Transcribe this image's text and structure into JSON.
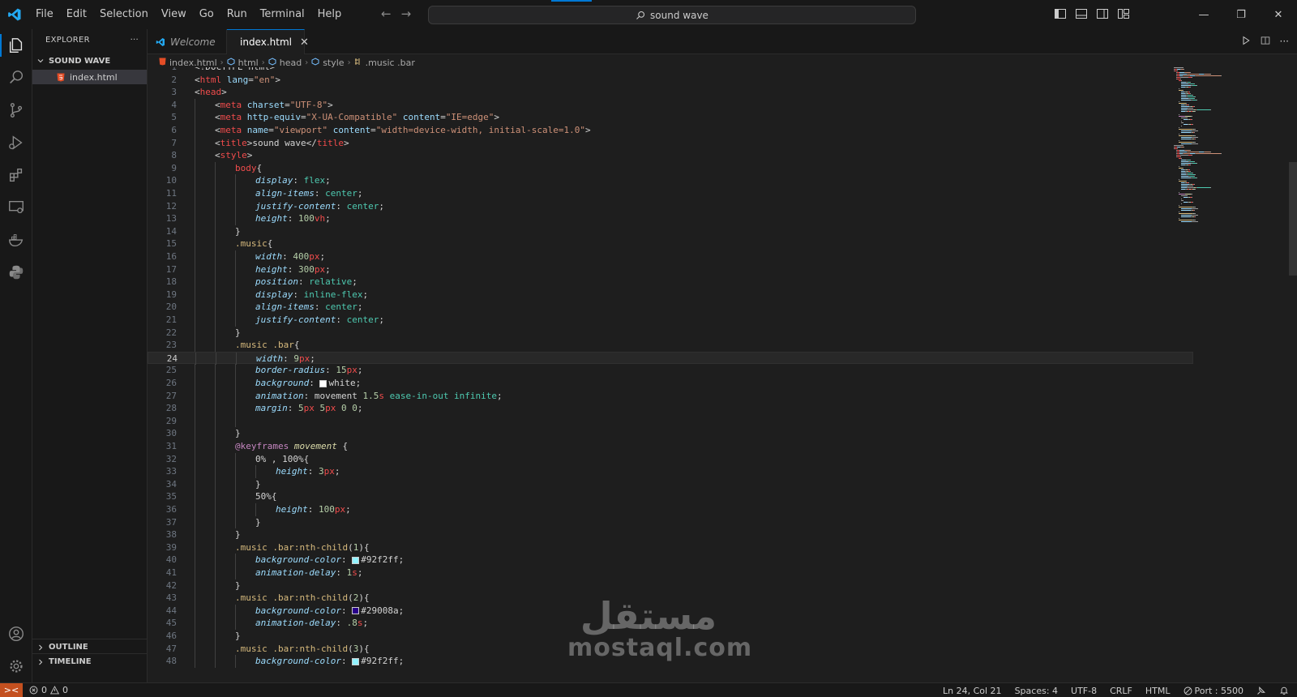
{
  "window": {
    "search_text": "sound wave"
  },
  "menu": [
    "File",
    "Edit",
    "Selection",
    "View",
    "Go",
    "Run",
    "Terminal",
    "Help"
  ],
  "sidebar": {
    "title": "EXPLORER",
    "more": "···",
    "folder": "SOUND WAVE",
    "files": [
      "index.html"
    ],
    "outline": "OUTLINE",
    "timeline": "TIMELINE"
  },
  "tabs": [
    {
      "label": "Welcome",
      "active": false
    },
    {
      "label": "index.html",
      "active": true
    }
  ],
  "breadcrumb": [
    "index.html",
    "html",
    "head",
    "style",
    ".music .bar"
  ],
  "editor": {
    "current_line": 24,
    "lines": [
      {
        "n": 1,
        "indent": 0,
        "tokens": [
          [
            "p",
            "<!DOCTYPE html>"
          ]
        ]
      },
      {
        "n": 2,
        "indent": 0,
        "tokens": [
          [
            "p",
            "<"
          ],
          [
            "t",
            "html"
          ],
          [
            "a",
            " lang"
          ],
          [
            "p",
            "="
          ],
          [
            "s",
            "\"en\""
          ],
          [
            "p",
            ">"
          ]
        ]
      },
      {
        "n": 3,
        "indent": 0,
        "tokens": [
          [
            "p",
            "<"
          ],
          [
            "t",
            "head"
          ],
          [
            "p",
            ">"
          ]
        ]
      },
      {
        "n": 4,
        "indent": 1,
        "tokens": [
          [
            "p",
            "<"
          ],
          [
            "t",
            "meta"
          ],
          [
            "a",
            " charset"
          ],
          [
            "p",
            "="
          ],
          [
            "s",
            "\"UTF-8\""
          ],
          [
            "p",
            ">"
          ]
        ]
      },
      {
        "n": 5,
        "indent": 1,
        "tokens": [
          [
            "p",
            "<"
          ],
          [
            "t",
            "meta"
          ],
          [
            "a",
            " http-equiv"
          ],
          [
            "p",
            "="
          ],
          [
            "s",
            "\"X-UA-Compatible\""
          ],
          [
            "a",
            " content"
          ],
          [
            "p",
            "="
          ],
          [
            "s",
            "\"IE=edge\""
          ],
          [
            "p",
            ">"
          ]
        ]
      },
      {
        "n": 6,
        "indent": 1,
        "tokens": [
          [
            "p",
            "<"
          ],
          [
            "t",
            "meta"
          ],
          [
            "a",
            " name"
          ],
          [
            "p",
            "="
          ],
          [
            "s",
            "\"viewport\""
          ],
          [
            "a",
            " content"
          ],
          [
            "p",
            "="
          ],
          [
            "s",
            "\"width=device-width, initial-scale=1.0\""
          ],
          [
            "p",
            ">"
          ]
        ]
      },
      {
        "n": 7,
        "indent": 1,
        "tokens": [
          [
            "p",
            "<"
          ],
          [
            "t",
            "title"
          ],
          [
            "p",
            ">sound wave</"
          ],
          [
            "t",
            "title"
          ],
          [
            "p",
            ">"
          ]
        ]
      },
      {
        "n": 8,
        "indent": 1,
        "tokens": [
          [
            "p",
            "<"
          ],
          [
            "t",
            "style"
          ],
          [
            "p",
            ">"
          ]
        ]
      },
      {
        "n": 9,
        "indent": 2,
        "tokens": [
          [
            "t",
            "body"
          ],
          [
            "p",
            "{"
          ]
        ]
      },
      {
        "n": 10,
        "indent": 3,
        "tokens": [
          [
            "prop",
            "display"
          ],
          [
            "p",
            ": "
          ],
          [
            "val",
            "flex"
          ],
          [
            "p",
            ";"
          ]
        ]
      },
      {
        "n": 11,
        "indent": 3,
        "tokens": [
          [
            "prop",
            "align-items"
          ],
          [
            "p",
            ": "
          ],
          [
            "val",
            "center"
          ],
          [
            "p",
            ";"
          ]
        ]
      },
      {
        "n": 12,
        "indent": 3,
        "tokens": [
          [
            "prop",
            "justify-content"
          ],
          [
            "p",
            ": "
          ],
          [
            "val",
            "center"
          ],
          [
            "p",
            ";"
          ]
        ]
      },
      {
        "n": 13,
        "indent": 3,
        "tokens": [
          [
            "prop",
            "height"
          ],
          [
            "p",
            ": "
          ],
          [
            "num",
            "100"
          ],
          [
            "unit",
            "vh"
          ],
          [
            "p",
            ";"
          ]
        ]
      },
      {
        "n": 14,
        "indent": 2,
        "tokens": [
          [
            "p",
            "}"
          ]
        ]
      },
      {
        "n": 15,
        "indent": 2,
        "tokens": [
          [
            "sel",
            ".music"
          ],
          [
            "p",
            "{"
          ]
        ]
      },
      {
        "n": 16,
        "indent": 3,
        "tokens": [
          [
            "prop",
            "width"
          ],
          [
            "p",
            ": "
          ],
          [
            "num",
            "400"
          ],
          [
            "unit",
            "px"
          ],
          [
            "p",
            ";"
          ]
        ]
      },
      {
        "n": 17,
        "indent": 3,
        "tokens": [
          [
            "prop",
            "height"
          ],
          [
            "p",
            ": "
          ],
          [
            "num",
            "300"
          ],
          [
            "unit",
            "px"
          ],
          [
            "p",
            ";"
          ]
        ]
      },
      {
        "n": 18,
        "indent": 3,
        "tokens": [
          [
            "prop",
            "position"
          ],
          [
            "p",
            ": "
          ],
          [
            "val",
            "relative"
          ],
          [
            "p",
            ";"
          ]
        ]
      },
      {
        "n": 19,
        "indent": 3,
        "tokens": [
          [
            "prop",
            "display"
          ],
          [
            "p",
            ": "
          ],
          [
            "val",
            "inline-flex"
          ],
          [
            "p",
            ";"
          ]
        ]
      },
      {
        "n": 20,
        "indent": 3,
        "tokens": [
          [
            "prop",
            "align-items"
          ],
          [
            "p",
            ": "
          ],
          [
            "val",
            "center"
          ],
          [
            "p",
            ";"
          ]
        ]
      },
      {
        "n": 21,
        "indent": 3,
        "tokens": [
          [
            "prop",
            "justify-content"
          ],
          [
            "p",
            ": "
          ],
          [
            "val",
            "center"
          ],
          [
            "p",
            ";"
          ]
        ]
      },
      {
        "n": 22,
        "indent": 2,
        "tokens": [
          [
            "p",
            "}"
          ]
        ]
      },
      {
        "n": 23,
        "indent": 2,
        "tokens": [
          [
            "sel",
            ".music .bar"
          ],
          [
            "p",
            "{"
          ]
        ]
      },
      {
        "n": 24,
        "indent": 3,
        "tokens": [
          [
            "prop",
            "width"
          ],
          [
            "p",
            ": "
          ],
          [
            "num",
            "9"
          ],
          [
            "unit",
            "px"
          ],
          [
            "p",
            ";"
          ]
        ]
      },
      {
        "n": 25,
        "indent": 3,
        "tokens": [
          [
            "prop",
            "border-radius"
          ],
          [
            "p",
            ": "
          ],
          [
            "num",
            "15"
          ],
          [
            "unit",
            "px"
          ],
          [
            "p",
            ";"
          ]
        ]
      },
      {
        "n": 26,
        "indent": 3,
        "tokens": [
          [
            "prop",
            "background"
          ],
          [
            "p",
            ": "
          ],
          [
            "swatch",
            "#ffffff"
          ],
          [
            "p",
            "white;"
          ]
        ]
      },
      {
        "n": 27,
        "indent": 3,
        "tokens": [
          [
            "prop",
            "animation"
          ],
          [
            "p",
            ": movement "
          ],
          [
            "num",
            "1.5"
          ],
          [
            "unit",
            "s"
          ],
          [
            "val",
            " ease-in-out infinite"
          ],
          [
            "p",
            ";"
          ]
        ]
      },
      {
        "n": 28,
        "indent": 3,
        "tokens": [
          [
            "prop",
            "margin"
          ],
          [
            "p",
            ": "
          ],
          [
            "num",
            "5"
          ],
          [
            "unit",
            "px"
          ],
          [
            "num",
            " 5"
          ],
          [
            "unit",
            "px"
          ],
          [
            "num",
            " 0 0"
          ],
          [
            "p",
            ";"
          ]
        ]
      },
      {
        "n": 29,
        "indent": 3,
        "tokens": []
      },
      {
        "n": 30,
        "indent": 2,
        "tokens": [
          [
            "p",
            "}"
          ]
        ]
      },
      {
        "n": 31,
        "indent": 2,
        "tokens": [
          [
            "kw",
            "@keyframes"
          ],
          [
            "anim",
            " movement"
          ],
          [
            "p",
            " {"
          ]
        ]
      },
      {
        "n": 32,
        "indent": 3,
        "tokens": [
          [
            "p",
            "0% , 100%{"
          ]
        ]
      },
      {
        "n": 33,
        "indent": 4,
        "tokens": [
          [
            "prop",
            "height"
          ],
          [
            "p",
            ": "
          ],
          [
            "num",
            "3"
          ],
          [
            "unit",
            "px"
          ],
          [
            "p",
            ";"
          ]
        ]
      },
      {
        "n": 34,
        "indent": 3,
        "tokens": [
          [
            "p",
            "}"
          ]
        ]
      },
      {
        "n": 35,
        "indent": 3,
        "tokens": [
          [
            "p",
            "50%{"
          ]
        ]
      },
      {
        "n": 36,
        "indent": 4,
        "tokens": [
          [
            "prop",
            "height"
          ],
          [
            "p",
            ": "
          ],
          [
            "num",
            "100"
          ],
          [
            "unit",
            "px"
          ],
          [
            "p",
            ";"
          ]
        ]
      },
      {
        "n": 37,
        "indent": 3,
        "tokens": [
          [
            "p",
            "}"
          ]
        ]
      },
      {
        "n": 38,
        "indent": 2,
        "tokens": [
          [
            "p",
            "}"
          ]
        ]
      },
      {
        "n": 39,
        "indent": 2,
        "tokens": [
          [
            "sel",
            ".music .bar:nth-child"
          ],
          [
            "p",
            "("
          ],
          [
            "num",
            "1"
          ],
          [
            "p",
            ")"
          ],
          [
            "p",
            "{"
          ]
        ]
      },
      {
        "n": 40,
        "indent": 3,
        "tokens": [
          [
            "prop",
            "background-color"
          ],
          [
            "p",
            ": "
          ],
          [
            "swatch",
            "#92f2ff"
          ],
          [
            "p",
            "#92f2ff;"
          ]
        ]
      },
      {
        "n": 41,
        "indent": 3,
        "tokens": [
          [
            "prop",
            "animation-delay"
          ],
          [
            "p",
            ": "
          ],
          [
            "num",
            "1"
          ],
          [
            "unit",
            "s"
          ],
          [
            "p",
            ";"
          ]
        ]
      },
      {
        "n": 42,
        "indent": 2,
        "tokens": [
          [
            "p",
            "}"
          ]
        ]
      },
      {
        "n": 43,
        "indent": 2,
        "tokens": [
          [
            "sel",
            ".music .bar:nth-child"
          ],
          [
            "p",
            "("
          ],
          [
            "num",
            "2"
          ],
          [
            "p",
            ")"
          ],
          [
            "p",
            "{"
          ]
        ]
      },
      {
        "n": 44,
        "indent": 3,
        "tokens": [
          [
            "prop",
            "background-color"
          ],
          [
            "p",
            ": "
          ],
          [
            "swatch",
            "#29008a"
          ],
          [
            "p",
            "#29008a;"
          ]
        ]
      },
      {
        "n": 45,
        "indent": 3,
        "tokens": [
          [
            "prop",
            "animation-delay"
          ],
          [
            "p",
            ": "
          ],
          [
            "num",
            ".8"
          ],
          [
            "unit",
            "s"
          ],
          [
            "p",
            ";"
          ]
        ]
      },
      {
        "n": 46,
        "indent": 2,
        "tokens": [
          [
            "p",
            "}"
          ]
        ]
      },
      {
        "n": 47,
        "indent": 2,
        "tokens": [
          [
            "sel",
            ".music .bar:nth-child"
          ],
          [
            "p",
            "("
          ],
          [
            "num",
            "3"
          ],
          [
            "p",
            ")"
          ],
          [
            "p",
            "{"
          ]
        ]
      },
      {
        "n": 48,
        "indent": 3,
        "tokens": [
          [
            "prop",
            "background-color"
          ],
          [
            "p",
            ": "
          ],
          [
            "swatch",
            "#92f2ff"
          ],
          [
            "p",
            "#92f2ff;"
          ]
        ]
      }
    ]
  },
  "watermark": {
    "arabic": "مستقل",
    "latin": "mostaql.com"
  },
  "status": {
    "errors": "0",
    "warnings": "0",
    "position": "Ln 24, Col 21",
    "spaces": "Spaces: 4",
    "encoding": "UTF-8",
    "eol": "CRLF",
    "language": "HTML",
    "port": "Port : 5500"
  },
  "colors": {
    "accent": "#0078d4",
    "remote": "#c4501f",
    "html_icon": "#e44d26",
    "vscode_blue": "#23a9f2"
  }
}
